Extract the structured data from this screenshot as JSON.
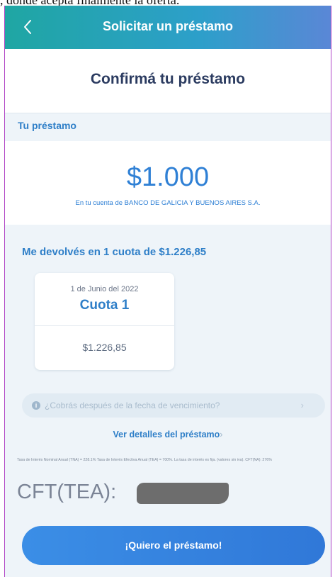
{
  "caption": ", donde acepta finalmente la oferta.",
  "header": {
    "title": "Solicitar un préstamo",
    "back_icon": "chevron-left-icon"
  },
  "confirm": {
    "title": "Confirmá tu préstamo"
  },
  "loan": {
    "section_label": "Tu préstamo",
    "amount": "$1.000",
    "destination": "En tu cuenta de BANCO DE GALICIA Y BUENOS AIRES S.A."
  },
  "repayment": {
    "title": "Me devolvés en 1 cuota de $1.226,85",
    "installments": [
      {
        "date": "1 de Junio del 2022",
        "label": "Cuota 1",
        "amount": "$1.226,85"
      }
    ]
  },
  "due_info": {
    "text": "¿Cobrás después de la fecha de vencimiento?",
    "icon": "info-icon",
    "chevron": "›"
  },
  "details_link": {
    "label": "Ver detalles del préstamo",
    "chevron": "›"
  },
  "fine_print": "Tasa de Interés Nominal Anual (TNA) = 228.1% Tasa de Interés Efectiva Anual (TEA) = 700%. La tasa de interés es fija. (valores sin iva). CFT(NA): 276%",
  "cft": {
    "label": "CFT(TEA):"
  },
  "cta": {
    "label": "¡Quiero el préstamo!"
  },
  "colors": {
    "accent": "#2f7fc8",
    "header_start": "#1fa6a3",
    "header_end": "#5a87d6",
    "background": "#eef4f9",
    "button": "#3078d8"
  }
}
